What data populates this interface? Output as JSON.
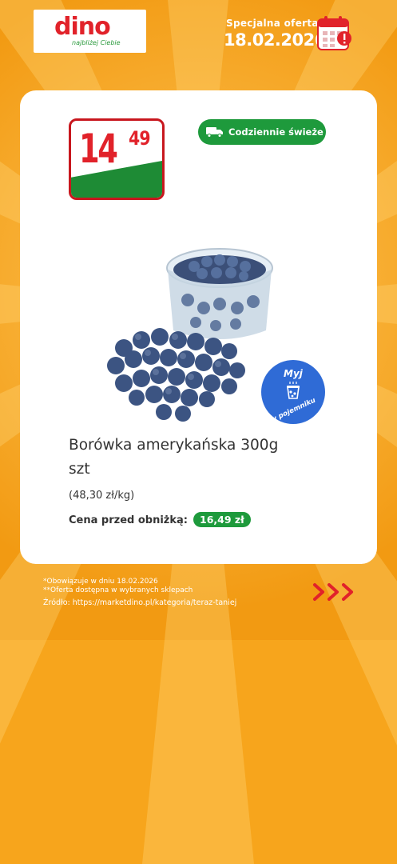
{
  "brand": {
    "name": "dino",
    "tagline": "najbliżej Ciebie"
  },
  "offer": {
    "title": "Specjalna oferta",
    "date": "18.02.2026"
  },
  "colors": {
    "brand_red": "#e1222a",
    "green": "#1e9a3c",
    "orange": "#f7a51c",
    "blue": "#2f6bd6"
  },
  "price": {
    "main": "14",
    "cents": "49"
  },
  "badge": {
    "label": "Codziennie świeże",
    "icon": "delivery-truck-icon"
  },
  "wash_badge": {
    "top": "Myj",
    "bottom": "w pojemniku"
  },
  "product": {
    "name_line1": "Borówka amerykańska 300g",
    "name_line2": "szt",
    "unit_price": "(48,30 zł/kg)",
    "prev_price_label": "Cena przed obniżką:",
    "prev_price_value": "16,49 zł"
  },
  "footer": {
    "line1": "*Obowiązuje w dniu 18.02.2026",
    "line2": "**Oferta dostępna w wybranych sklepach",
    "source": "Źródło: https://marketdino.pl/kategoria/teraz-taniej"
  }
}
